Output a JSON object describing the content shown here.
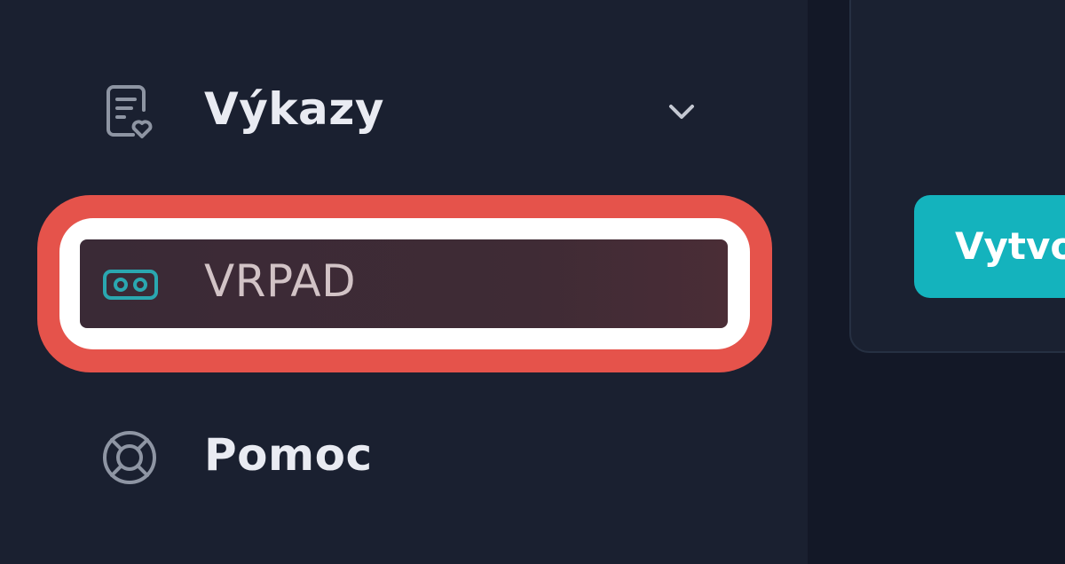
{
  "sidebar": {
    "items": [
      {
        "label": "Výkazy",
        "icon": "report-heart-icon",
        "expandable": true
      },
      {
        "label": "VRPAD",
        "icon": "vr-headset-icon",
        "highlighted": true
      },
      {
        "label": "Pomoc",
        "icon": "lifebuoy-icon"
      }
    ]
  },
  "main": {
    "create_button_label": "Vytvo"
  },
  "colors": {
    "sidebar_bg": "#1a2030",
    "accent": "#14b3bd",
    "highlight": "#e5534b",
    "vr_icon": "#2aa7b0"
  }
}
